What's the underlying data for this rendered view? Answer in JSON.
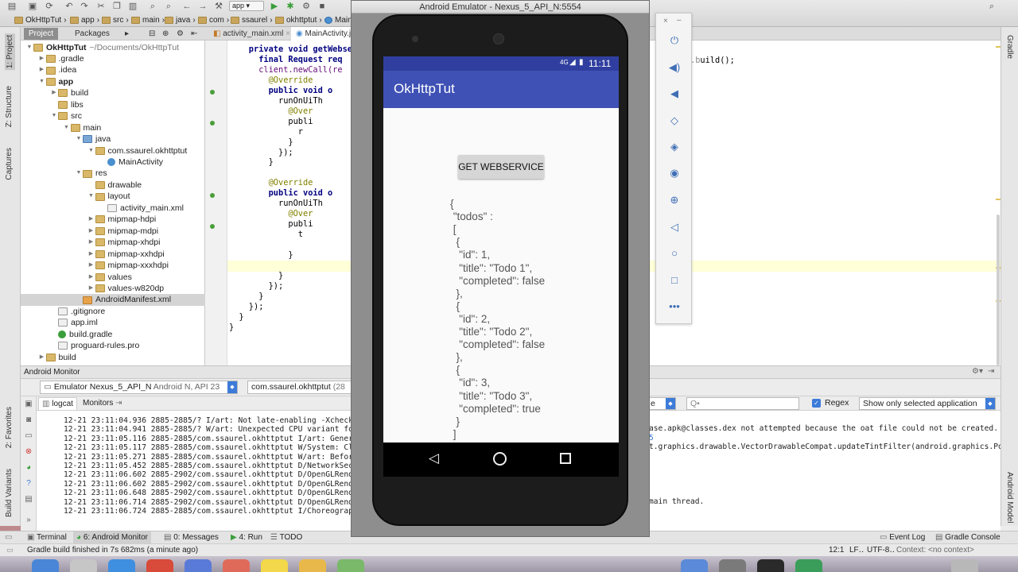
{
  "toolbar": {
    "breadcrumbs": [
      "OkHttpTut",
      "app",
      "src",
      "main",
      "java",
      "com",
      "ssaurel",
      "okhttptut",
      "MainA"
    ],
    "run_config": "app"
  },
  "left_strip": {
    "project": "1: Project",
    "structure": "Z: Structure",
    "captures": "Captures",
    "favorites": "2: Favorites",
    "build_variants": "Build Variants"
  },
  "right_strip": {
    "gradle": "Gradle",
    "android_model": "Android Model"
  },
  "project_panel": {
    "tabs": [
      "Project",
      "Packages"
    ],
    "tree": [
      {
        "label": "OkHttpTut",
        "extra": "~/Documents/OkHttpTut",
        "level": 0,
        "icon": "folder",
        "expanded": true
      },
      {
        "label": ".gradle",
        "level": 1,
        "icon": "folder",
        "expanded": false
      },
      {
        "label": ".idea",
        "level": 1,
        "icon": "folder",
        "expanded": false
      },
      {
        "label": "app",
        "level": 1,
        "icon": "folder",
        "expanded": true
      },
      {
        "label": "build",
        "level": 2,
        "icon": "folder",
        "expanded": false
      },
      {
        "label": "libs",
        "level": 2,
        "icon": "folder",
        "expanded": null
      },
      {
        "label": "src",
        "level": 2,
        "icon": "folder",
        "expanded": true
      },
      {
        "label": "main",
        "level": 3,
        "icon": "folder",
        "expanded": true
      },
      {
        "label": "java",
        "level": 4,
        "icon": "java",
        "expanded": true
      },
      {
        "label": "com.ssaurel.okhttptut",
        "level": 5,
        "icon": "folder",
        "expanded": true
      },
      {
        "label": "MainActivity",
        "level": 6,
        "icon": "class",
        "expanded": null
      },
      {
        "label": "res",
        "level": 4,
        "icon": "folder",
        "expanded": true
      },
      {
        "label": "drawable",
        "level": 5,
        "icon": "folder",
        "expanded": null
      },
      {
        "label": "layout",
        "level": 5,
        "icon": "folder",
        "expanded": true
      },
      {
        "label": "activity_main.xml",
        "level": 6,
        "icon": "file",
        "expanded": null
      },
      {
        "label": "mipmap-hdpi",
        "level": 5,
        "icon": "folder",
        "expanded": false
      },
      {
        "label": "mipmap-mdpi",
        "level": 5,
        "icon": "folder",
        "expanded": false
      },
      {
        "label": "mipmap-xhdpi",
        "level": 5,
        "icon": "folder",
        "expanded": false
      },
      {
        "label": "mipmap-xxhdpi",
        "level": 5,
        "icon": "folder",
        "expanded": false
      },
      {
        "label": "mipmap-xxxhdpi",
        "level": 5,
        "icon": "folder",
        "expanded": false
      },
      {
        "label": "values",
        "level": 5,
        "icon": "folder",
        "expanded": false
      },
      {
        "label": "values-w820dp",
        "level": 5,
        "icon": "folder",
        "expanded": false
      },
      {
        "label": "AndroidManifest.xml",
        "level": 4,
        "icon": "xml",
        "expanded": null,
        "selected": true
      },
      {
        "label": ".gitignore",
        "level": 2,
        "icon": "file",
        "expanded": null
      },
      {
        "label": "app.iml",
        "level": 2,
        "icon": "file",
        "expanded": null
      },
      {
        "label": "build.gradle",
        "level": 2,
        "icon": "gradle",
        "expanded": null
      },
      {
        "label": "proguard-rules.pro",
        "level": 2,
        "icon": "file",
        "expanded": null
      },
      {
        "label": "build",
        "level": 1,
        "icon": "folder",
        "expanded": false
      }
    ]
  },
  "editor": {
    "tabs": [
      "activity_main.xml",
      "MainActivity.j"
    ],
    "right_code": "uild();",
    "lines": [
      "    private void getWebse",
      "      final Request req",
      "      client.newCall(re",
      "        @Override",
      "        public void o",
      "          runOnUiTh",
      "            @Over",
      "            publi",
      "              r",
      "            }",
      "          });",
      "        }",
      "",
      "        @Override",
      "        public void o",
      "          runOnUiTh",
      "            @Over",
      "            publi",
      "              t",
      "",
      "            }",
      "",
      "          }",
      "        });",
      "      }",
      "    });",
      "  }",
      "}"
    ]
  },
  "monitor": {
    "title": "Android Monitor",
    "device": "Emulator Nexus_5_API_N",
    "device_api": "Android N, API 23",
    "process": "com.ssaurel.okhttptut",
    "process_pid": "(28",
    "tabs": [
      "logcat",
      "Monitors"
    ],
    "log_level": "e",
    "search_placeholder": "Q•",
    "regex_label": "Regex",
    "filter": "Show only selected application",
    "log_lines": [
      "12-21 23:11:04.936 2885-2885/? I/art: Not late-enabling -Xcheck:jni",
      "12-21 23:11:04.941 2885-2885/? W/art: Unexpected CPU variant for X86",
      "12-21 23:11:05.116 2885-2885/com.ssaurel.okhttptut I/art: Generation",
      "12-21 23:11:05.117 2885-2885/com.ssaurel.okhttptut W/System: ClassLo",
      "12-21 23:11:05.271 2885-2885/com.ssaurel.okhttptut W/art: Before And",
      "12-21 23:11:05.452 2885-2885/com.ssaurel.okhttptut D/NetworkSecurity",
      "12-21 23:11:06.602 2885-2902/com.ssaurel.okhttptut D/OpenGLRenderer:",
      "12-21 23:11:06.602 2885-2902/com.ssaurel.okhttptut D/OpenGLRenderer:",
      "12-21 23:11:06.648 2885-2902/com.ssaurel.okhttptut D/OpenGLRenderer:",
      "12-21 23:11:06.714 2885-2902/com.ssaurel.okhttptut D/OpenGLRenderer:",
      "12-21 23:11:06.724 2885-2885/com.ssaurel.okhttptut I/Choreographer:"
    ],
    "log_right": [
      "ase.apk@classes.dex not attempted because the oat file could not be created.",
      "5",
      "t.graphics.drawable.VectorDrawableCompat.updateTintFilter(android.graphics.PorterDu",
      "main thread."
    ]
  },
  "bottom_tabs": [
    {
      "label": "Terminal"
    },
    {
      "label": "6: Android Monitor"
    },
    {
      "label": "0: Messages"
    },
    {
      "label": "4: Run"
    },
    {
      "label": "TODO"
    },
    {
      "label": "Event Log"
    },
    {
      "label": "Gradle Console"
    }
  ],
  "status_bar": {
    "message": "Gradle build finished in 7s 682ms (a minute ago)",
    "position": "12:1",
    "line_sep": "LF‥",
    "encoding": "UTF-8‥",
    "context": "Context: <no context>"
  },
  "emulator": {
    "window_title": "Android Emulator - Nexus_5_API_N:5554",
    "status_time": "11:11",
    "signal": "4G",
    "app_title": "OkHttpTut",
    "button_label": "GET WEBSERVICE",
    "json_lines": [
      "{",
      " \"todos\" :",
      " [",
      "  {",
      "   \"id\": 1,",
      "   \"title\": \"Todo 1\",",
      "   \"completed\": false",
      "  },",
      "  {",
      "   \"id\": 2,",
      "   \"title\": \"Todo 2\",",
      "   \"completed\": false",
      "  },",
      "  {",
      "   \"id\": 3,",
      "   \"title\": \"Todo 3\",",
      "   \"completed\": true",
      "  }",
      " ]"
    ]
  },
  "colors": {
    "primary": "#3f51b5",
    "primary_dark": "#303f9f",
    "accent_blue": "#3d7bd9"
  }
}
